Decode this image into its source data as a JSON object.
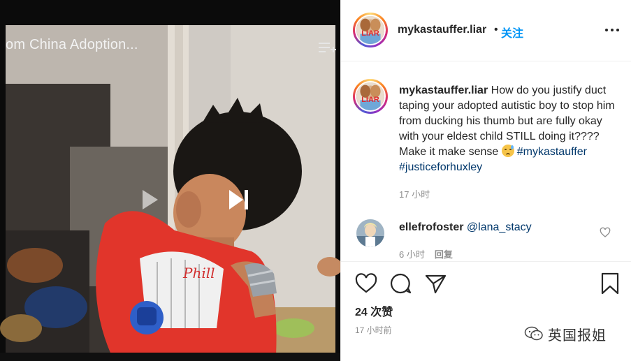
{
  "video": {
    "title": "om China Adoption...",
    "queue_icon": "add-to-queue-icon",
    "prev_icon": "play-prev-icon",
    "next_icon": "skip-next-icon"
  },
  "header": {
    "avatar_text": "LIAR",
    "username": "mykastauffer.liar",
    "separator": "•",
    "follow_label": "关注",
    "more_icon": "more-options-icon"
  },
  "caption": {
    "avatar_text": "LIAR",
    "username": "mykastauffer.liar",
    "text": "How do you justify duct taping your adopted autistic boy to stop him from ducking his thumb but are fully okay with your eldest child STILL doing it???? Make it make sense",
    "emoji": "sad-sweat-emoji",
    "hashtags": [
      "#mykastauffer",
      "#justiceforhuxley"
    ],
    "time": "17 小时"
  },
  "comment": {
    "username": "ellefrofoster",
    "mention": "@lana_stacy",
    "time": "6 小时",
    "reply_label": "回复",
    "like_icon": "heart-outline-icon"
  },
  "actions": {
    "like_icon": "heart-icon",
    "comment_icon": "comment-icon",
    "share_icon": "paper-plane-icon",
    "save_icon": "bookmark-icon",
    "likes_text": "24 次赞",
    "post_time": "17 小时前"
  },
  "watermark": {
    "text": "英国报姐",
    "icon": "wechat-icon"
  },
  "colors": {
    "link_blue": "#0095f6",
    "hashtag": "#00376b",
    "muted": "#8e8e8e",
    "liar_red": "#e0282e"
  }
}
